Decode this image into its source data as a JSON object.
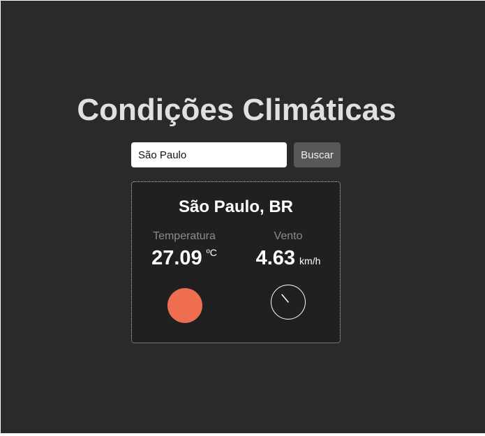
{
  "page": {
    "title": "Condições Climáticas"
  },
  "search": {
    "value": "São Paulo",
    "button_label": "Buscar"
  },
  "weather": {
    "city": "São Paulo, BR",
    "temperature": {
      "label": "Temperatura",
      "value": "27.09",
      "unit": "ºC",
      "indicator_color": "#ee6e4f",
      "icon": "temperature-circle-icon"
    },
    "wind": {
      "label": "Vento",
      "value": "4.63",
      "unit": "km/h",
      "direction_deg": 320,
      "icon": "wind-direction-icon"
    }
  },
  "colors": {
    "background": "#2a2a2a",
    "card_background": "#202020",
    "button": "#585858"
  }
}
